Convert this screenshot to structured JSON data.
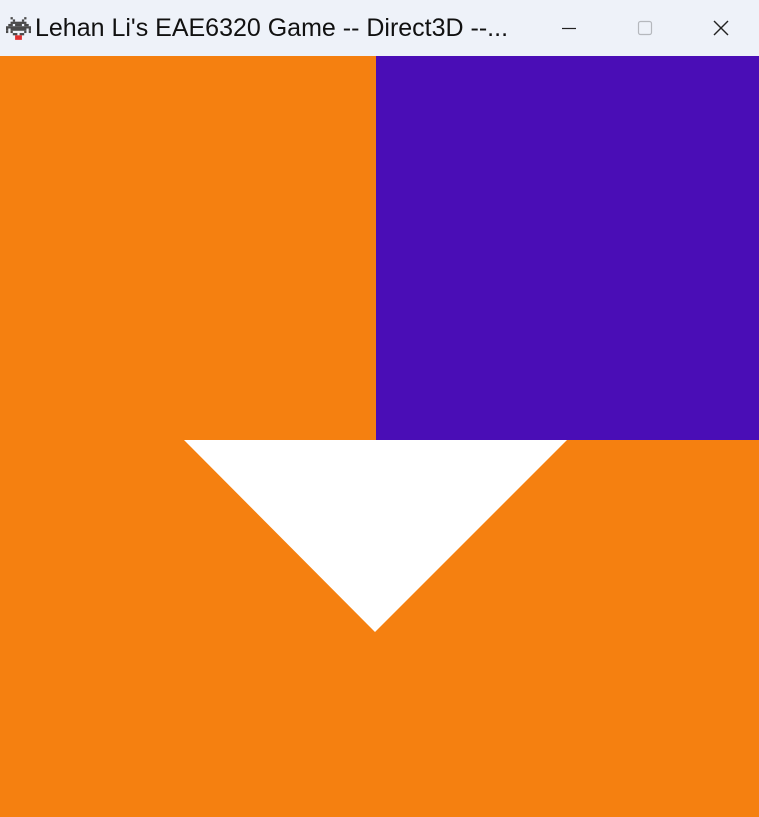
{
  "window": {
    "title": "Lehan Li's EAE6320 Game -- Direct3D --...",
    "app_icon": "space-invader-icon",
    "controls": {
      "minimize_icon": "minimize-icon",
      "maximize_icon": "maximize-icon",
      "close_icon": "close-icon"
    }
  },
  "scene": {
    "background_color": "#F58010",
    "shapes": [
      {
        "kind": "rectangle",
        "color": "#4A0DB6"
      },
      {
        "kind": "triangle",
        "color": "#FFFFFF"
      }
    ]
  },
  "colors": {
    "titlebar": "#EEF2F9",
    "title_text": "#111111"
  }
}
